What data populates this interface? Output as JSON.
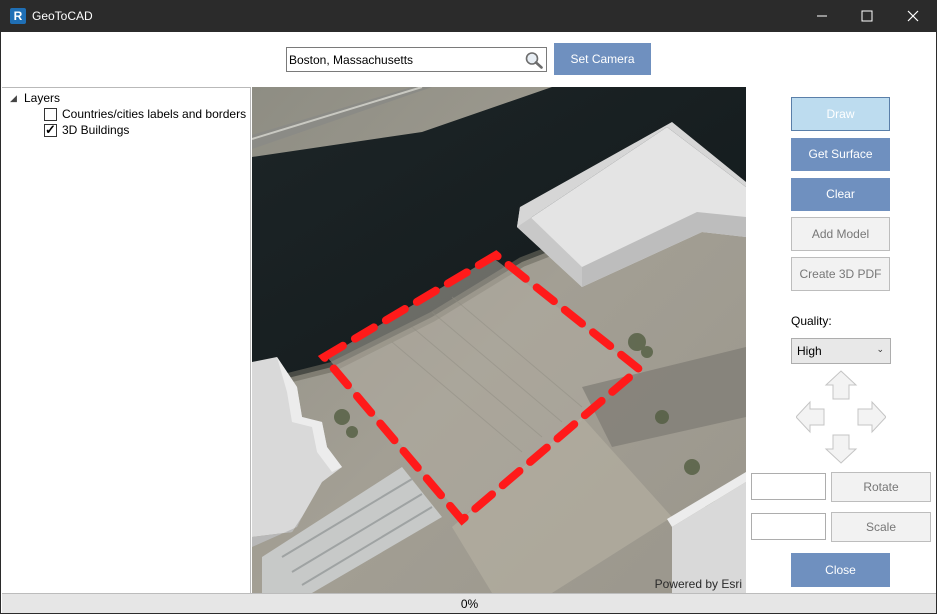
{
  "window": {
    "title": "GeoToCAD",
    "app_icon_letter": "R"
  },
  "search": {
    "value": "Boston, Massachusetts"
  },
  "buttons": {
    "set_camera": "Set Camera",
    "draw": "Draw",
    "get_surface": "Get Surface",
    "clear": "Clear",
    "add_model": "Add Model",
    "create_3d_pdf": "Create 3D PDF",
    "rotate": "Rotate",
    "scale": "Scale",
    "close": "Close"
  },
  "layers": {
    "root_label": "Layers",
    "items": [
      {
        "label": "Countries/cities labels and borders",
        "checked": false
      },
      {
        "label": "3D Buildings",
        "checked": true
      }
    ]
  },
  "quality": {
    "label": "Quality:",
    "selected": "High"
  },
  "inputs": {
    "rotate_value": "",
    "scale_value": ""
  },
  "map": {
    "credit": "Powered by Esri",
    "selection_color": "#ff1a1a"
  },
  "status": {
    "progress": "0%",
    "progress_fraction": 0
  },
  "colors": {
    "titlebar": "#2b2b2b",
    "button_blue": "#6f90bf",
    "button_draw": "#bddcef"
  }
}
